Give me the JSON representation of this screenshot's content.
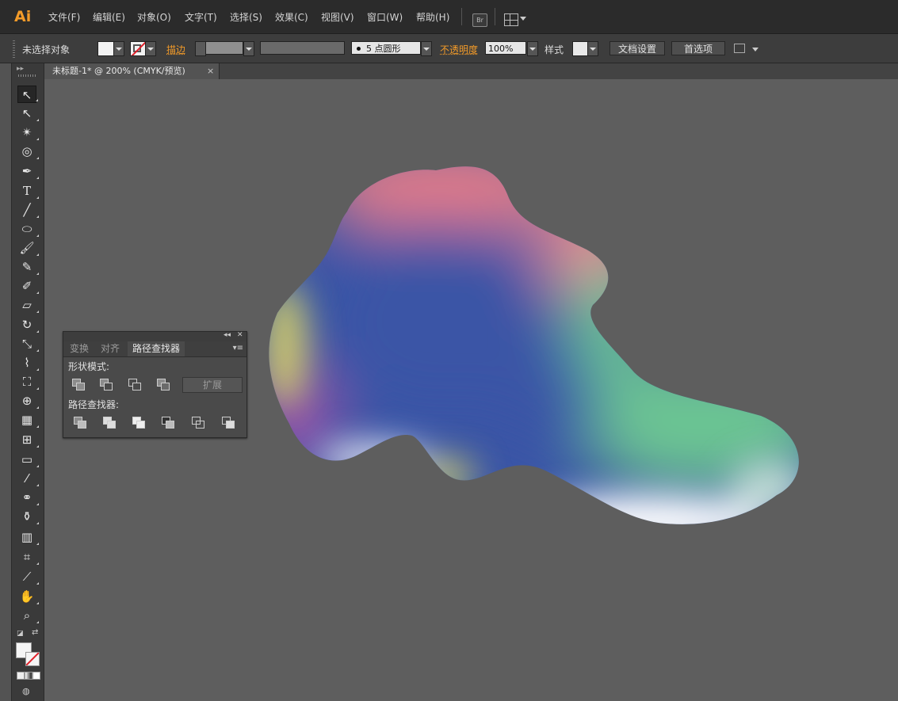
{
  "app": {
    "logo": "Ai",
    "menu": [
      "文件(F)",
      "编辑(E)",
      "对象(O)",
      "文字(T)",
      "选择(S)",
      "效果(C)",
      "视图(V)",
      "窗口(W)",
      "帮助(H)"
    ],
    "bridge_label": "Br"
  },
  "control_bar": {
    "selection_status": "未选择对象",
    "stroke_label": "描边",
    "brush_value": "5 点圆形",
    "opacity_label": "不透明度",
    "opacity_value": "100%",
    "style_label": "样式",
    "doc_setup_button": "文档设置",
    "preferences_button": "首选项"
  },
  "document": {
    "tab_title": "未标题-1* @ 200% (CMYK/预览)",
    "tab_close": "×"
  },
  "tools": [
    "selection-tool",
    "direct-selection-tool",
    "magic-wand-tool",
    "lasso-tool",
    "pen-tool",
    "type-tool",
    "line-tool",
    "ellipse-tool",
    "paintbrush-tool",
    "pencil-tool",
    "blob-brush-tool",
    "eraser-tool",
    "rotate-tool",
    "scale-tool",
    "warp-tool",
    "free-transform-tool",
    "shape-builder-tool",
    "perspective-grid-tool",
    "mesh-tool",
    "gradient-tool",
    "eyedropper-tool",
    "blend-tool",
    "symbol-sprayer-tool",
    "column-graph-tool",
    "artboard-tool",
    "slice-tool",
    "hand-tool",
    "zoom-tool"
  ],
  "panel": {
    "tabs": [
      "变换",
      "对齐",
      "路径查找器"
    ],
    "active_tab": "路径查找器",
    "shape_modes_label": "形状模式:",
    "expand_button": "扩展",
    "pathfinders_label": "路径查找器:"
  },
  "artwork": {
    "colors": {
      "pink": "#e97e86",
      "blue": "#3a55a6",
      "green": "#6cc493",
      "yellow": "#e8e060",
      "magenta": "#c04fa8",
      "white": "#ffffff"
    }
  }
}
